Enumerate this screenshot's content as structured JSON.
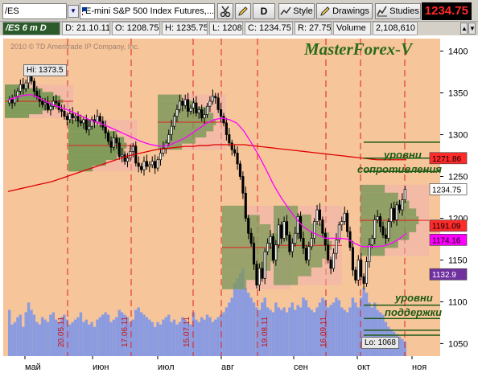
{
  "toolbar": {
    "symbol_value": "/ES",
    "description": "E-mini S&P 500 Index Futures,...",
    "period_label": "D",
    "style_label": "Style",
    "drawings_label": "Drawings",
    "studies_label": "Studies",
    "last_price": "1234.75"
  },
  "infobar": {
    "symbol": "/ES 6 m D",
    "date": "D: 21.10.11",
    "open": "O: 1208.75",
    "high": "H: 1235.75",
    "low": "L: 1208",
    "close": "C: 1234.75",
    "range": "R: 27.75",
    "volume_label": "Volume",
    "volume_value": "2,108,610"
  },
  "overlay": {
    "brand": "MasterForex-V",
    "copyright": "2010 © TD Ameritrade IP Company, Inc.",
    "hi_label": "Hi: 1373.5",
    "lo_label": "Lo: 1068",
    "resistance_line1": "уровни",
    "resistance_line2": "сопротивления",
    "support_line1": "уровни",
    "support_line2": "поддержки"
  },
  "colors": {
    "background": "#f6c59a",
    "volume": "#8b9be0",
    "up_candle": "#ffffff",
    "down_candle": "#000000",
    "ma_short": "#ff00ff",
    "ma_long": "#e00000",
    "profile": "#4e8e3a",
    "resistance_tag": "#ff2a2a",
    "magenta_tag": "#ff00ff",
    "purple_tag": "#7030a0"
  },
  "chart_data": {
    "type": "candlestick",
    "title": "",
    "xlabel": "",
    "ylabel": "",
    "ylim": [
      1035,
      1415
    ],
    "y_ticks": [
      1050,
      1100,
      1150,
      1200,
      1250,
      1300,
      1350,
      1400
    ],
    "x_month_labels": [
      "май",
      "июн",
      "июл",
      "авг",
      "сен",
      "окт",
      "ноя"
    ],
    "vertical_date_labels": [
      "20.05.11",
      "17.06.11",
      "15.07.11",
      "19.08.11",
      "16.09.11"
    ],
    "grid": false,
    "price_tags": [
      {
        "value": "1271.86",
        "color": "red"
      },
      {
        "value": "1234.75",
        "color": "white"
      },
      {
        "value": "1191.09",
        "color": "red"
      },
      {
        "value": "1174.16",
        "color": "magenta"
      },
      {
        "value": "1132.9",
        "color": "purple"
      }
    ],
    "series": [
      {
        "name": "price",
        "close": [
          1342,
          1338,
          1346,
          1352,
          1360,
          1355,
          1362,
          1370,
          1364,
          1352,
          1346,
          1340,
          1336,
          1338,
          1330,
          1334,
          1340,
          1338,
          1330,
          1328,
          1322,
          1318,
          1325,
          1320,
          1322,
          1316,
          1314,
          1318,
          1306,
          1310,
          1318,
          1315,
          1322,
          1316,
          1309,
          1302,
          1292,
          1285,
          1296,
          1290,
          1274,
          1276,
          1268,
          1272,
          1280,
          1286,
          1266,
          1262,
          1258,
          1268,
          1262,
          1264,
          1268,
          1260,
          1270,
          1278,
          1284,
          1290,
          1300,
          1310,
          1322,
          1330,
          1340,
          1335,
          1342,
          1328,
          1332,
          1338,
          1326,
          1330,
          1320,
          1324,
          1334,
          1340,
          1346,
          1344,
          1330,
          1322,
          1314,
          1300,
          1290,
          1282,
          1278,
          1265,
          1250,
          1230,
          1200,
          1182,
          1170,
          1145,
          1120,
          1140,
          1128,
          1160,
          1170,
          1178,
          1150,
          1168,
          1192,
          1176,
          1196,
          1180,
          1160,
          1170,
          1182,
          1202,
          1176,
          1164,
          1150,
          1166,
          1176,
          1196,
          1210,
          1198,
          1182,
          1168,
          1150,
          1140,
          1158,
          1174,
          1192,
          1196,
          1206,
          1184,
          1165,
          1138,
          1126,
          1150,
          1130,
          1122,
          1148,
          1168,
          1176,
          1198,
          1202,
          1190,
          1180,
          1176,
          1196,
          1212,
          1198,
          1216,
          1210,
          1222,
          1234.75
        ],
        "volume": [
          95,
          65,
          70,
          80,
          85,
          60,
          90,
          110,
          95,
          85,
          70,
          65,
          80,
          75,
          70,
          85,
          90,
          75,
          70,
          80,
          85,
          75,
          65,
          70,
          75,
          80,
          90,
          70,
          75,
          65,
          70,
          60,
          75,
          80,
          85,
          90,
          85,
          70,
          75,
          80,
          95,
          90,
          85,
          80,
          70,
          75,
          95,
          100,
          90,
          85,
          80,
          75,
          70,
          60,
          70,
          65,
          75,
          80,
          85,
          70,
          75,
          65,
          70,
          80,
          75,
          70,
          65,
          90,
          75,
          70,
          80,
          75,
          85,
          80,
          70,
          75,
          80,
          85,
          90,
          100,
          110,
          120,
          150,
          160,
          170,
          180,
          140,
          130,
          120,
          110,
          100,
          95,
          110,
          120,
          100,
          95,
          90,
          110,
          100,
          95,
          100,
          90,
          100,
          110,
          95,
          105,
          100,
          120,
          115,
          100,
          95,
          90,
          100,
          110,
          120,
          115,
          100,
          105,
          110,
          120,
          115,
          100,
          95,
          90,
          100,
          120,
          110,
          100,
          120,
          140,
          130,
          110,
          100,
          110,
          95,
          90,
          85,
          70,
          60,
          55,
          50,
          45,
          40,
          35,
          30
        ]
      },
      {
        "name": "ma_short",
        "values": [
          1342,
          1344,
          1347,
          1348,
          1345,
          1340,
          1336,
          1333,
          1330,
          1326,
          1322,
          1318,
          1315,
          1312,
          1308,
          1304,
          1300,
          1296,
          1292,
          1289,
          1287,
          1286,
          1288,
          1292,
          1296,
          1302,
          1308,
          1314,
          1318,
          1320,
          1318,
          1314,
          1304,
          1290,
          1275,
          1258,
          1240,
          1225,
          1212,
          1200,
          1190,
          1184,
          1180,
          1176,
          1176,
          1176,
          1175,
          1170,
          1166,
          1166,
          1166,
          1167,
          1170,
          1175,
          1182
        ]
      },
      {
        "name": "ma_long",
        "values": [
          1232,
          1234,
          1236,
          1238,
          1240,
          1242,
          1244,
          1247,
          1250,
          1253,
          1256,
          1259,
          1262,
          1265,
          1268,
          1271,
          1274,
          1276,
          1278,
          1280,
          1282,
          1283,
          1284,
          1285,
          1286,
          1286,
          1287,
          1287,
          1288,
          1288,
          1288,
          1288,
          1288,
          1287,
          1286,
          1285,
          1284,
          1283,
          1282,
          1281,
          1280,
          1279,
          1278,
          1277,
          1276,
          1275,
          1274,
          1273,
          1272,
          1271,
          1270,
          1270,
          1270,
          1270,
          1270
        ]
      }
    ]
  }
}
